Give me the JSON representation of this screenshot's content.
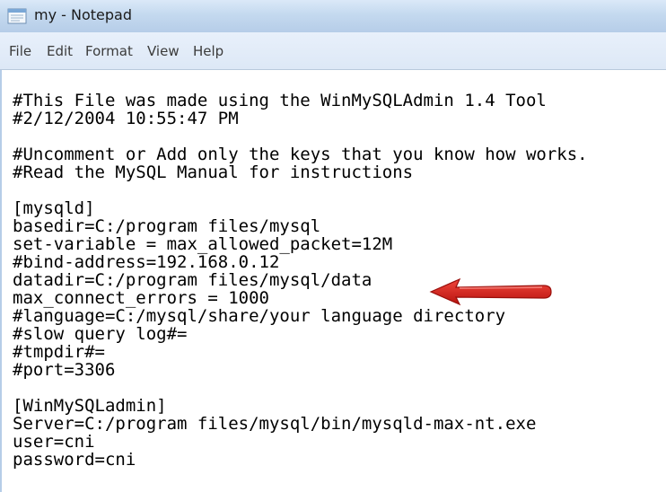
{
  "window": {
    "title": "my - Notepad",
    "icon": "notepad-icon"
  },
  "menu": {
    "items": [
      "File",
      "Edit",
      "Format",
      "View",
      "Help"
    ]
  },
  "editor": {
    "lines": [
      "#This File was made using the WinMySQLAdmin 1.4 Tool",
      "#2/12/2004 10:55:47 PM",
      "",
      "#Uncomment or Add only the keys that you know how works.",
      "#Read the MySQL Manual for instructions",
      "",
      "[mysqld]",
      "basedir=C:/program files/mysql",
      "set-variable = max_allowed_packet=12M",
      "#bind-address=192.168.0.12",
      "datadir=C:/program files/mysql/data",
      "max_connect_errors = 1000",
      "#language=C:/mysql/share/your language directory",
      "#slow query log#=",
      "#tmpdir#=",
      "#port=3306",
      "",
      "[WinMySQLadmin]",
      "Server=C:/program files/mysql/bin/mysqld-max-nt.exe",
      "user=cni",
      "password=cni"
    ]
  },
  "annotation": {
    "icon": "red-arrow-icon",
    "color": "#e0241b"
  },
  "colors": {
    "titlebar": "#c4d9ef",
    "menubar": "#dde8f6",
    "text": "#000000"
  }
}
